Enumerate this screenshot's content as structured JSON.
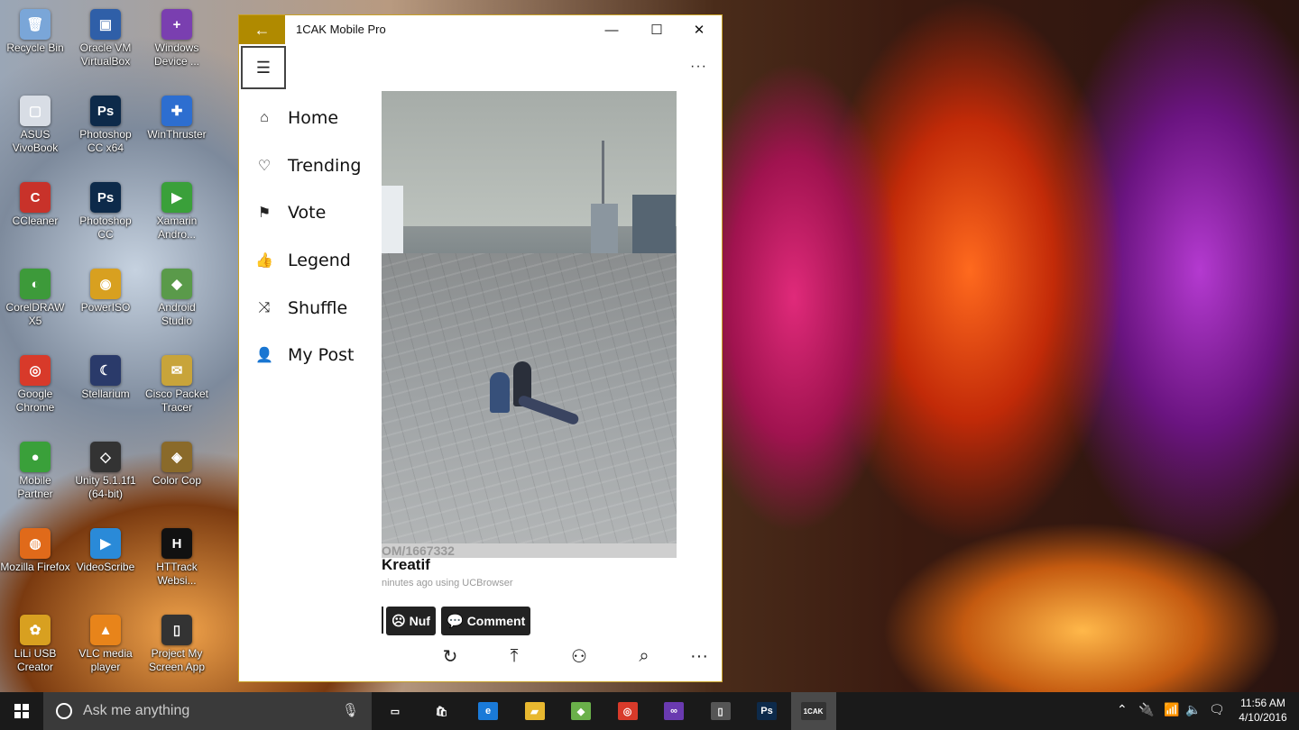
{
  "desktop": {
    "icons": [
      {
        "label": "Recycle Bin",
        "glyph": "🗑",
        "color": "#7aa6d8",
        "col": 0,
        "row": 0
      },
      {
        "label": "Oracle VM VirtualBox",
        "glyph": "▣",
        "color": "#2f5fa8",
        "col": 1,
        "row": 0
      },
      {
        "label": "Windows Device ...",
        "glyph": "+",
        "color": "#7a3fb0",
        "col": 2,
        "row": 0
      },
      {
        "label": "ASUS VivoBook",
        "glyph": "▢",
        "color": "#d8dde5",
        "col": 0,
        "row": 1
      },
      {
        "label": "Photoshop CC x64",
        "glyph": "Ps",
        "color": "#0d2a4a",
        "col": 1,
        "row": 1
      },
      {
        "label": "WinThruster",
        "glyph": "✚",
        "color": "#2d6ed0",
        "col": 2,
        "row": 1
      },
      {
        "label": "CCleaner",
        "glyph": "C",
        "color": "#c8322a",
        "col": 0,
        "row": 2
      },
      {
        "label": "Photoshop CC",
        "glyph": "Ps",
        "color": "#0d2a4a",
        "col": 1,
        "row": 2
      },
      {
        "label": "Xamarin Andro...",
        "glyph": "▶",
        "color": "#3aa03a",
        "col": 2,
        "row": 2
      },
      {
        "label": "CorelDRAW X5",
        "glyph": "◐",
        "color": "#3d9a3a",
        "col": 0,
        "row": 3
      },
      {
        "label": "PowerISO",
        "glyph": "◉",
        "color": "#d8a020",
        "col": 1,
        "row": 3
      },
      {
        "label": "Android Studio",
        "glyph": "◆",
        "color": "#5a9a4a",
        "col": 2,
        "row": 3
      },
      {
        "label": "Google Chrome",
        "glyph": "◎",
        "color": "#d83a2a",
        "col": 0,
        "row": 4
      },
      {
        "label": "Stellarium",
        "glyph": "☾",
        "color": "#2a3a6a",
        "col": 1,
        "row": 4
      },
      {
        "label": "Cisco Packet Tracer",
        "glyph": "✉",
        "color": "#c8a43a",
        "col": 2,
        "row": 4
      },
      {
        "label": "Mobile Partner",
        "glyph": "●",
        "color": "#3aa03a",
        "col": 0,
        "row": 5
      },
      {
        "label": "Unity 5.1.1f1 (64-bit)",
        "glyph": "◇",
        "color": "#333333",
        "col": 1,
        "row": 5
      },
      {
        "label": "Color Cop",
        "glyph": "◈",
        "color": "#8a6a2a",
        "col": 2,
        "row": 5
      },
      {
        "label": "Mozilla Firefox",
        "glyph": "◍",
        "color": "#e06a1a",
        "col": 0,
        "row": 6
      },
      {
        "label": "VideoScribe",
        "glyph": "▶",
        "color": "#2a8ad8",
        "col": 1,
        "row": 6
      },
      {
        "label": "HTTrack Websi...",
        "glyph": "H",
        "color": "#111111",
        "col": 2,
        "row": 6
      },
      {
        "label": "LiLi USB Creator",
        "glyph": "✿",
        "color": "#d8a020",
        "col": 0,
        "row": 7
      },
      {
        "label": "VLC media player",
        "glyph": "▲",
        "color": "#e8841a",
        "col": 1,
        "row": 7
      },
      {
        "label": "Project My Screen App",
        "glyph": "▯",
        "color": "#333333",
        "col": 2,
        "row": 7
      }
    ]
  },
  "window": {
    "title": "1CAK Mobile Pro",
    "back_icon": "←",
    "minimize_icon": "—",
    "maximize_icon": "☐",
    "close_icon": "✕",
    "accent_color": "#b08a00",
    "more_label": "···"
  },
  "nav": {
    "items": [
      {
        "label": "Home",
        "icon": "⌂"
      },
      {
        "label": "Trending",
        "icon": "♡"
      },
      {
        "label": "Vote",
        "icon": "⚑"
      },
      {
        "label": "Legend",
        "icon": "👍"
      },
      {
        "label": "Shuffle",
        "icon": "⤨"
      },
      {
        "label": "My Post",
        "icon": "👤"
      }
    ]
  },
  "post": {
    "watermark": "OM/1667332",
    "title": "Kreatif",
    "meta": "ninutes ago using UCBrowser",
    "nuf_label": "Nuf",
    "comment_label": "Comment"
  },
  "bottom_bar": {
    "refresh_icon": "↻",
    "top_icon": "⤒",
    "users_icon": "⚇",
    "search_icon": "⌕",
    "more_icon": "···"
  },
  "taskbar": {
    "search_placeholder": "Ask me anything",
    "clock_time": "11:56 AM",
    "clock_date": "4/10/2016",
    "apps": [
      {
        "name": "task-view",
        "glyph": "▭",
        "color": "transparent"
      },
      {
        "name": "store",
        "glyph": "🛍",
        "color": "transparent"
      },
      {
        "name": "edge",
        "glyph": "e",
        "color": "#1a7ad8"
      },
      {
        "name": "file-explorer",
        "glyph": "▰",
        "color": "#e8b830"
      },
      {
        "name": "maps",
        "glyph": "◆",
        "color": "#6ab04a"
      },
      {
        "name": "chrome",
        "glyph": "◎",
        "color": "#d83a2a"
      },
      {
        "name": "visual-studio",
        "glyph": "∞",
        "color": "#6a3ab0"
      },
      {
        "name": "phone",
        "glyph": "▯",
        "color": "#555555"
      },
      {
        "name": "photoshop",
        "glyph": "Ps",
        "color": "#0d2a4a"
      },
      {
        "name": "1cak",
        "glyph": "1CAK",
        "color": "#333333"
      }
    ]
  }
}
